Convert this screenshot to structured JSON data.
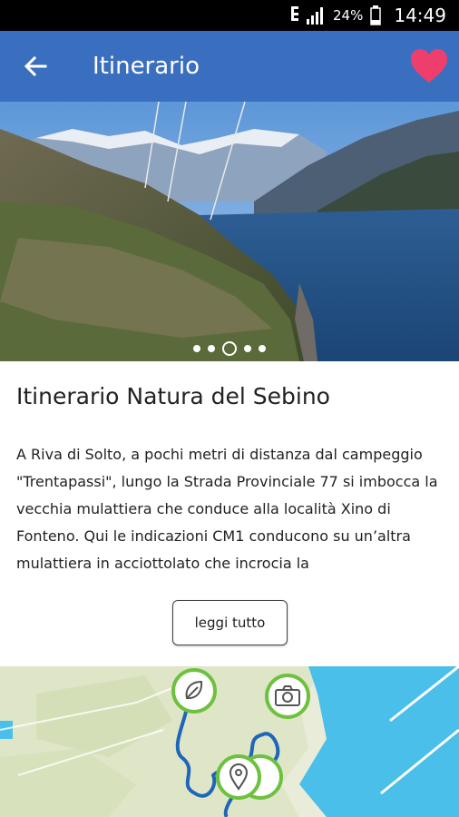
{
  "status_bar": {
    "battery": "24%",
    "time": "14:49",
    "icons": [
      "nfc-icon",
      "signal-icon",
      "battery-icon"
    ]
  },
  "app_bar": {
    "title": "Itinerario",
    "back_icon": "arrow-left-icon",
    "favorite_icon": "heart-icon",
    "colors": {
      "background": "#3a6fc0",
      "heart": "#ee3f6c"
    }
  },
  "gallery": {
    "slides": 5,
    "active_slide": 3
  },
  "itinerary": {
    "title": "Itinerario Natura del Sebino",
    "description": "A Riva di Solto, a pochi metri di distanza dal campeggio \"Trentapassi\", lungo la Strada Provinciale 77 si imbocca la vecchia mulattiera che conduce alla località Xino di Fonteno. Qui le indicazioni CM1 conducono su un’altra mulattiera in acciottolato che incrocia la",
    "read_more_label": "leggi tutto"
  },
  "map": {
    "pins": [
      "leaf-icon",
      "camera-icon",
      "location-pin-icon"
    ],
    "colors": {
      "route": "#1f66b8",
      "pin_border": "#6ec13f",
      "water": "#49bfe9"
    }
  }
}
